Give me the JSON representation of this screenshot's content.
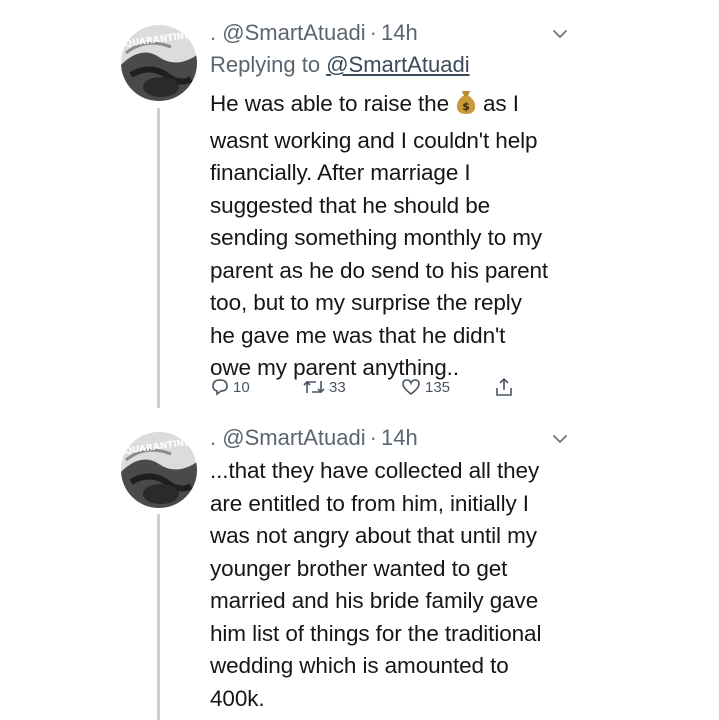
{
  "tweets": [
    {
      "author": {
        "prefix": ".",
        "handle": "@SmartAtuadi",
        "separator": "·",
        "time": "14h",
        "avatar_text": "QUARANTINE"
      },
      "replying_label": "Replying to",
      "replying_to": "@SmartAtuadi",
      "body_lines": [
        "He was able to raise the",
        "wasnt working and I couldn't help",
        "financially. After marriage I",
        "suggested that he should be",
        "sending something monthly to my",
        "parent as he do send to his parent",
        "too, but to my surprise the reply",
        "he gave me was that he didn't",
        "owe my parent anything.."
      ],
      "body_line1_tail": "as I",
      "emoji_icon": "money-bag-icon",
      "actions": {
        "replies": "10",
        "retweets": "33",
        "likes": "135"
      }
    },
    {
      "author": {
        "prefix": ".",
        "handle": "@SmartAtuadi",
        "separator": "·",
        "time": "14h",
        "avatar_text": "QUARANTINE"
      },
      "body_lines": [
        "...that they have collected all they",
        "are entitled to from him, initially I",
        "was not angry about that until my",
        "younger brother wanted to get",
        "married and his bride family gave",
        "him list of things for the traditional",
        "wedding which is amounted to",
        "400k."
      ]
    }
  ],
  "colors": {
    "text": "#14171a",
    "secondary": "#5b6570",
    "thread_line": "#c9cfd6",
    "background": "#ffffff"
  }
}
